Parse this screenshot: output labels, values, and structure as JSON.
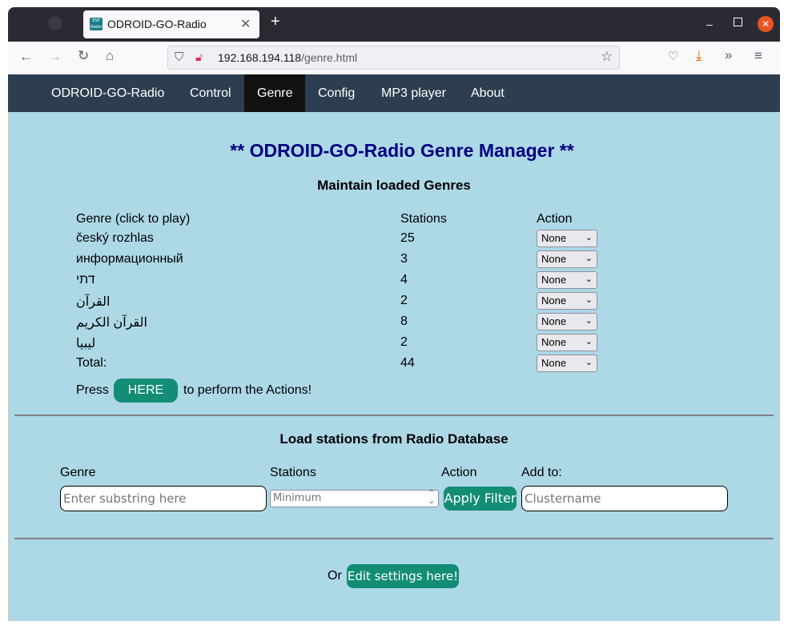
{
  "browser": {
    "tab_title": "ODROID-GO-Radio",
    "favicon_text": "ESP Radio",
    "url_host": "192.168.194.118",
    "url_path": "/genre.html"
  },
  "menu": {
    "items": [
      {
        "label": "ODROID-GO-Radio"
      },
      {
        "label": "Control"
      },
      {
        "label": "Genre"
      },
      {
        "label": "Config"
      },
      {
        "label": "MP3 player"
      },
      {
        "label": "About"
      }
    ],
    "active": "Genre"
  },
  "page": {
    "title": "** ODROID-GO-Radio Genre Manager **",
    "section1_title": "Maintain loaded Genres",
    "table_headers": {
      "genre": "Genre (click to play)",
      "stations": "Stations",
      "action": "Action"
    },
    "genres": [
      {
        "name": "český rozhlas",
        "stations": "25",
        "action": "None"
      },
      {
        "name": "информационный",
        "stations": "3",
        "action": "None"
      },
      {
        "name": "דתי",
        "stations": "4",
        "action": "None"
      },
      {
        "name": "القرآن",
        "stations": "2",
        "action": "None"
      },
      {
        "name": "القرآن الكريم",
        "stations": "8",
        "action": "None"
      },
      {
        "name": "ليبيا",
        "stations": "2",
        "action": "None"
      }
    ],
    "total": {
      "label": "Total:",
      "stations": "44",
      "action": "None"
    },
    "press_prefix": "Press",
    "here_button": "HERE",
    "press_suffix": "to perform the Actions!",
    "section2_title": "Load stations from Radio Database",
    "filter_headers": {
      "genre": "Genre",
      "stations": "Stations",
      "action": "Action",
      "add_to": "Add to:"
    },
    "genre_placeholder": "Enter substring here",
    "stations_placeholder": "Minimum",
    "apply_button": "Apply Filter",
    "cluster_placeholder": "Clustername",
    "or_text": "Or",
    "edit_button": "Edit settings here!"
  },
  "colors": {
    "page_bg": "#add8e6",
    "menubar_bg": "#2c3e50",
    "button_bg": "#138d75",
    "title_color": "#000080"
  }
}
